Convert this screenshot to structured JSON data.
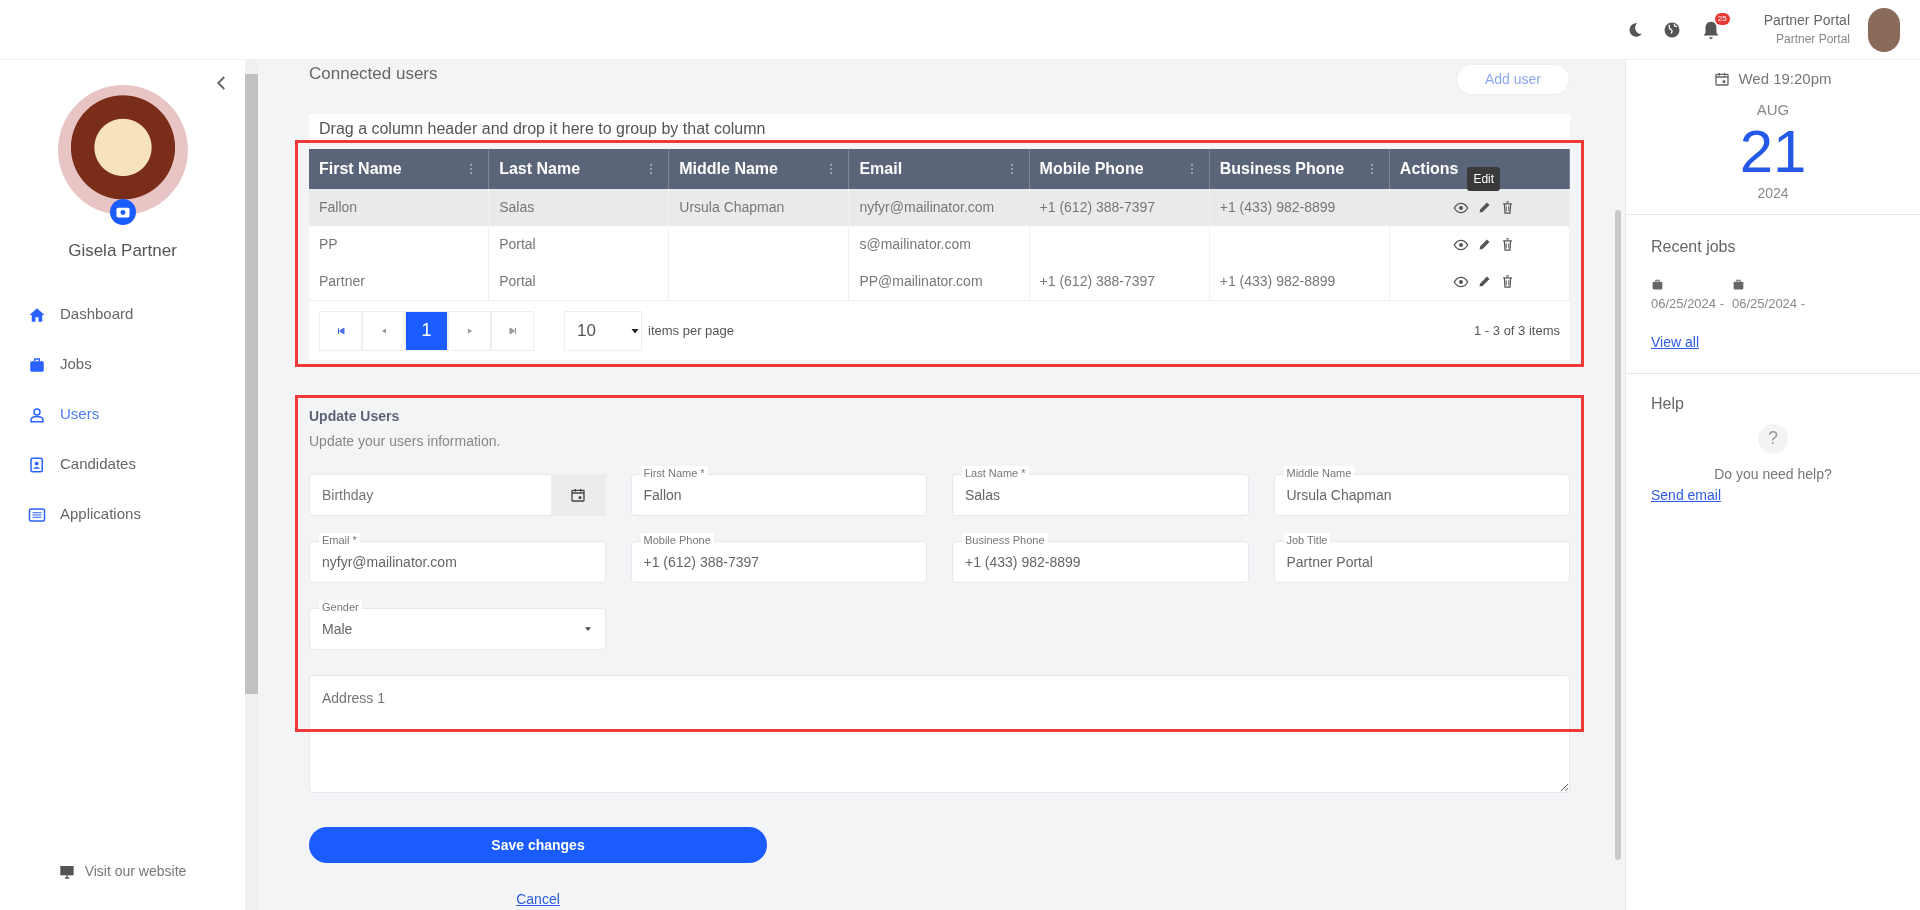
{
  "topbar": {
    "notification_count": "25",
    "user_name": "Partner Portal",
    "user_role": "Partner Portal"
  },
  "sidebar": {
    "user_name": "Gisela Partner",
    "items": [
      {
        "label": "Dashboard",
        "selected": false
      },
      {
        "label": "Jobs",
        "selected": false
      },
      {
        "label": "Users",
        "selected": true
      },
      {
        "label": "Candidates",
        "selected": false
      },
      {
        "label": "Applications",
        "selected": false
      }
    ],
    "footer_link": "Visit our website"
  },
  "main": {
    "title": "Connected users",
    "add_button": "Add user",
    "group_hint": "Drag a column header and drop it here to group by that column",
    "table": {
      "columns": [
        "First Name",
        "Last Name",
        "Middle Name",
        "Email",
        "Mobile Phone",
        "Business Phone",
        "Actions"
      ],
      "rows": [
        {
          "cells": [
            "Fallon",
            "Salas",
            "Ursula Chapman",
            "nyfyr@mailinator.com",
            "+1 (612) 388-7397",
            "+1 (433) 982-8899"
          ],
          "selected": true,
          "tooltip": "Edit"
        },
        {
          "cells": [
            "PP",
            "Portal",
            null,
            "s@mailinator.com",
            null,
            null
          ],
          "selected": false
        },
        {
          "cells": [
            "Partner",
            "Portal",
            null,
            "PP@mailinator.com",
            "+1 (612) 388-7397",
            "+1 (433) 982-8899"
          ],
          "selected": false
        }
      ]
    },
    "pager": {
      "pages": [
        {
          "label": "1",
          "selected": true
        }
      ],
      "page_size": "10",
      "page_size_label": "items per page",
      "summary": "1 - 3 of 3 items"
    }
  },
  "form": {
    "title": "Update Users",
    "subtitle": "Update your users information.",
    "fields": [
      {
        "kind": "date",
        "placeholder": "Birthday"
      },
      {
        "kind": "text",
        "label": "First Name *",
        "value": "Fallon"
      },
      {
        "kind": "text",
        "label": "Last Name *",
        "value": "Salas"
      },
      {
        "kind": "text",
        "label": "Middle Name",
        "value": "Ursula Chapman"
      },
      {
        "kind": "text",
        "label": "Email *",
        "value": "nyfyr@mailinator.com"
      },
      {
        "kind": "text",
        "label": "Mobile Phone",
        "value": "+1 (612) 388-7397"
      },
      {
        "kind": "text",
        "label": "Business Phone",
        "value": "+1 (433) 982-8899"
      },
      {
        "kind": "text",
        "label": "Job Title",
        "value": "Partner Portal"
      },
      {
        "kind": "select",
        "label": "Gender",
        "value": "Male"
      },
      {
        "kind": "textarea",
        "placeholder": "Address 1"
      }
    ],
    "save_button": "Save changes",
    "cancel_link": "Cancel"
  },
  "right_panel": {
    "weekday_time": "Wed 19:20pm",
    "month": "AUG",
    "day": "21",
    "year": "2024",
    "recent_jobs": {
      "title": "Recent jobs",
      "jobs": [
        "06/25/2024 -",
        "06/25/2024 -"
      ],
      "view_all": "View all"
    },
    "help": {
      "title": "Help",
      "icon_text": "?",
      "question": "Do you need help?",
      "link": "Send email"
    }
  }
}
